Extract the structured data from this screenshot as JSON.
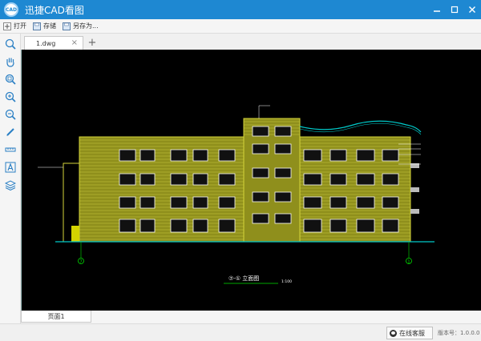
{
  "window": {
    "title": "迅捷CAD看图",
    "logo_text": "CAD",
    "minimize_icon": "minimize-icon",
    "maximize_icon": "maximize-icon",
    "close_icon": "close-icon"
  },
  "toolbar": {
    "open_label": "打开",
    "save_label": "存储",
    "save_as_label": "另存为..."
  },
  "sidetools": [
    {
      "name": "zoom-icon"
    },
    {
      "name": "pan-hand-icon"
    },
    {
      "name": "zoom-extents-icon"
    },
    {
      "name": "zoom-in-icon"
    },
    {
      "name": "zoom-out-icon"
    },
    {
      "name": "pen-icon"
    },
    {
      "name": "measure-icon"
    },
    {
      "name": "text-icon"
    },
    {
      "name": "layers-icon"
    }
  ],
  "tabs": {
    "file_name": "1.dwg",
    "close_glyph": "×",
    "add_glyph": "+"
  },
  "drawing": {
    "title_text": "⑦-①  立面图",
    "scale_text": "1:100",
    "axis_left": "7",
    "axis_right": "1",
    "background": "#000000",
    "facade_color": "#b5b52a",
    "ground_color": "#00c8c8",
    "window_color": "#ffffff",
    "annotation_color": "#ffffff"
  },
  "pages": {
    "page_label": "页面1"
  },
  "status": {
    "support_label": "在线客服",
    "version_text": "版本号：1.0.0.0"
  },
  "colors": {
    "titlebar": "#1e88d2",
    "accent": "#1e88d2"
  }
}
